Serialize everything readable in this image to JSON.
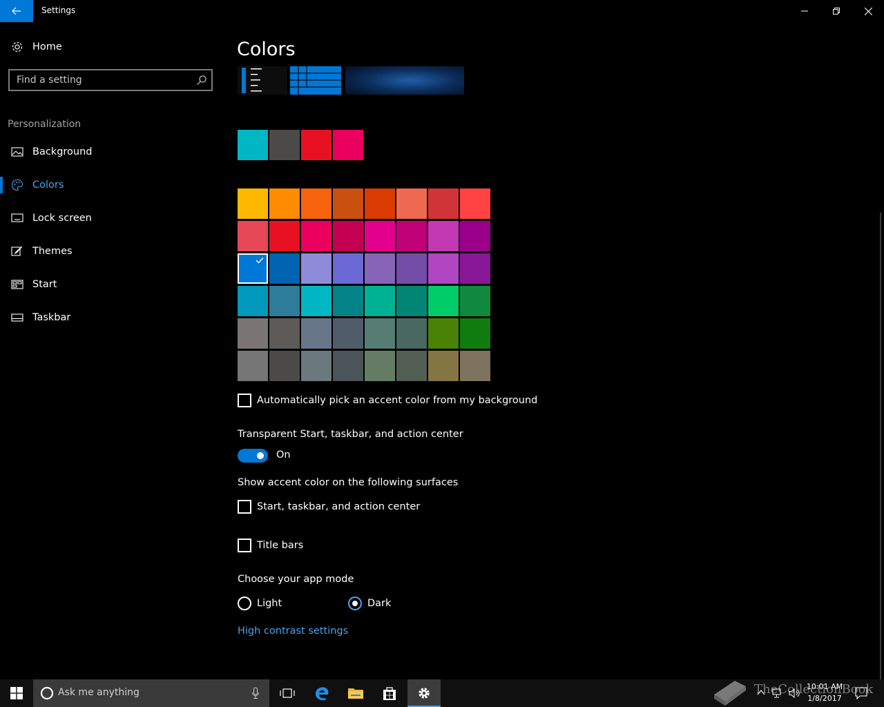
{
  "window": {
    "title": "Settings",
    "accent": "#0078d7"
  },
  "sidebar": {
    "home_label": "Home",
    "search_placeholder": "Find a setting",
    "section_header": "Personalization",
    "items": [
      {
        "label": "Background",
        "icon": "picture-icon",
        "active": false
      },
      {
        "label": "Colors",
        "icon": "palette-icon",
        "active": true
      },
      {
        "label": "Lock screen",
        "icon": "lock-screen-icon",
        "active": false
      },
      {
        "label": "Themes",
        "icon": "brush-icon",
        "active": false
      },
      {
        "label": "Start",
        "icon": "start-tiles-icon",
        "active": false
      },
      {
        "label": "Taskbar",
        "icon": "taskbar-icon",
        "active": false
      }
    ]
  },
  "main": {
    "title": "Colors",
    "recent_colors": [
      "#00b7c3",
      "#4c4a48",
      "#e81123",
      "#ea005e"
    ],
    "palette": [
      [
        "#ffb900",
        "#ff8c00",
        "#f7630c",
        "#ca5010",
        "#da3b01",
        "#ef6950",
        "#d13438",
        "#ff4343"
      ],
      [
        "#e74856",
        "#e81123",
        "#ea005e",
        "#c30052",
        "#e3008c",
        "#bf0077",
        "#c239b3",
        "#9a0089"
      ],
      [
        "#0078d7",
        "#0063b1",
        "#8e8cd8",
        "#6b69d6",
        "#8764b8",
        "#744da9",
        "#b146c2",
        "#881798"
      ],
      [
        "#0099bc",
        "#2d7d9a",
        "#00b7c3",
        "#038387",
        "#00b294",
        "#018574",
        "#00cc6a",
        "#10893e"
      ],
      [
        "#7a7574",
        "#5d5a58",
        "#68768a",
        "#515c6b",
        "#567c73",
        "#486860",
        "#498205",
        "#107c10"
      ],
      [
        "#767676",
        "#4c4a48",
        "#69797e",
        "#4a5459",
        "#647c64",
        "#525e54",
        "#847545",
        "#7e735f"
      ]
    ],
    "selected_color": "#0078d7",
    "auto_pick_label": "Automatically pick an accent color from my background",
    "auto_pick_checked": false,
    "transparency_label": "Transparent Start, taskbar, and action center",
    "transparency_state": "On",
    "surfaces_label": "Show accent color on the following surfaces",
    "surface_start_label": "Start, taskbar, and action center",
    "surface_start_checked": false,
    "surface_title_label": "Title bars",
    "surface_title_checked": false,
    "app_mode_label": "Choose your app mode",
    "app_mode_options": [
      "Light",
      "Dark"
    ],
    "app_mode_selected": "Dark",
    "high_contrast_link": "High contrast settings"
  },
  "taskbar": {
    "search_placeholder": "Ask me anything",
    "time": "10:01 AM",
    "date": "1/8/2017",
    "pinned": [
      "task-view-icon",
      "edge-icon",
      "file-explorer-icon",
      "store-icon",
      "settings-icon"
    ],
    "active_app": "settings-icon"
  },
  "watermark": {
    "text": "TheCollectionBook"
  }
}
